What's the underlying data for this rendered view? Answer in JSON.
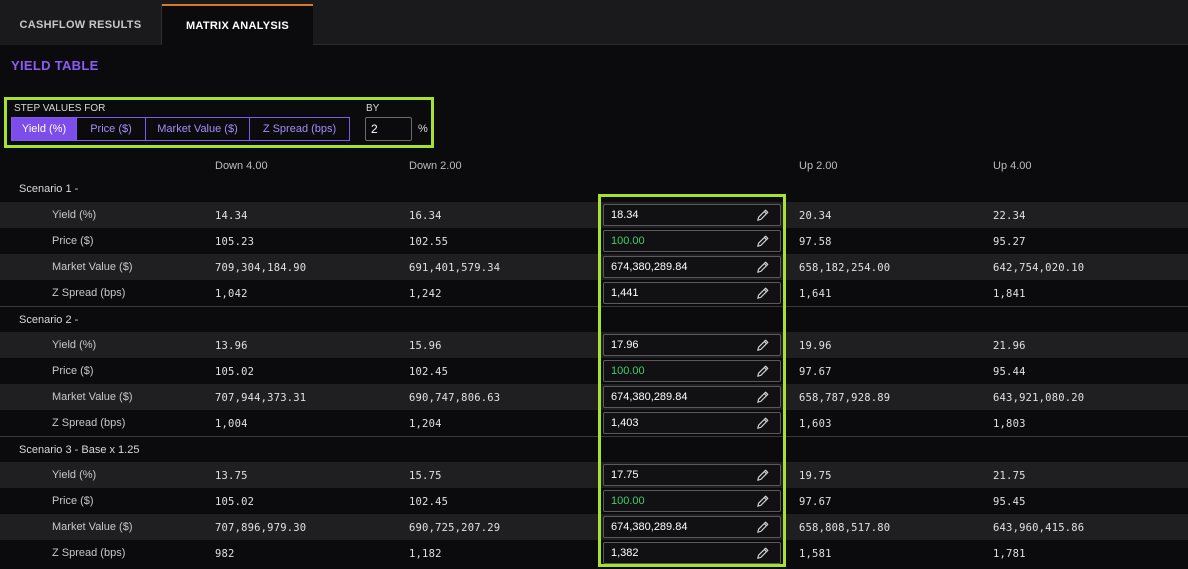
{
  "tabs": [
    {
      "label": "CASHFLOW RESULTS",
      "active": false
    },
    {
      "label": "MATRIX ANALYSIS",
      "active": true
    }
  ],
  "title": "YIELD TABLE",
  "step": {
    "label": "STEP VALUES FOR",
    "options": [
      "Yield (%)",
      "Price ($)",
      "Market Value ($)",
      "Z Spread (bps)"
    ],
    "selected": "Yield (%)",
    "by_label": "BY",
    "by_value": "2",
    "unit": "%"
  },
  "columns": [
    "Down 4.00",
    "Down 2.00",
    "",
    "Up 2.00",
    "Up 4.00"
  ],
  "scenarios": [
    {
      "name": "Scenario 1 -",
      "rows": [
        {
          "metric": "Yield (%)",
          "values": [
            "14.34",
            "16.34",
            "18.34",
            "20.34",
            "22.34"
          ]
        },
        {
          "metric": "Price ($)",
          "values": [
            "105.23",
            "102.55",
            "100.00",
            "97.58",
            "95.27"
          ]
        },
        {
          "metric": "Market Value ($)",
          "values": [
            "709,304,184.90",
            "691,401,579.34",
            "674,380,289.84",
            "658,182,254.00",
            "642,754,020.10"
          ]
        },
        {
          "metric": "Z Spread (bps)",
          "values": [
            "1,042",
            "1,242",
            "1,441",
            "1,641",
            "1,841"
          ]
        }
      ]
    },
    {
      "name": "Scenario 2 -",
      "rows": [
        {
          "metric": "Yield (%)",
          "values": [
            "13.96",
            "15.96",
            "17.96",
            "19.96",
            "21.96"
          ]
        },
        {
          "metric": "Price ($)",
          "values": [
            "105.02",
            "102.45",
            "100.00",
            "97.67",
            "95.44"
          ]
        },
        {
          "metric": "Market Value ($)",
          "values": [
            "707,944,373.31",
            "690,747,806.63",
            "674,380,289.84",
            "658,787,928.89",
            "643,921,080.20"
          ]
        },
        {
          "metric": "Z Spread (bps)",
          "values": [
            "1,004",
            "1,204",
            "1,403",
            "1,603",
            "1,803"
          ]
        }
      ]
    },
    {
      "name": "Scenario 3 - Base x 1.25",
      "rows": [
        {
          "metric": "Yield (%)",
          "values": [
            "13.75",
            "15.75",
            "17.75",
            "19.75",
            "21.75"
          ]
        },
        {
          "metric": "Price ($)",
          "values": [
            "105.02",
            "102.45",
            "100.00",
            "97.67",
            "95.45"
          ]
        },
        {
          "metric": "Market Value ($)",
          "values": [
            "707,896,979.30",
            "690,725,207.29",
            "674,380,289.84",
            "658,808,517.80",
            "643,960,415.86"
          ]
        },
        {
          "metric": "Z Spread (bps)",
          "values": [
            "982",
            "1,182",
            "1,382",
            "1,581",
            "1,781"
          ]
        }
      ]
    }
  ],
  "colors": {
    "accent": "#8b5cf6",
    "highlight": "#a6e22e",
    "active_tab": "#d9772b",
    "price_green": "#3ecf6a"
  }
}
